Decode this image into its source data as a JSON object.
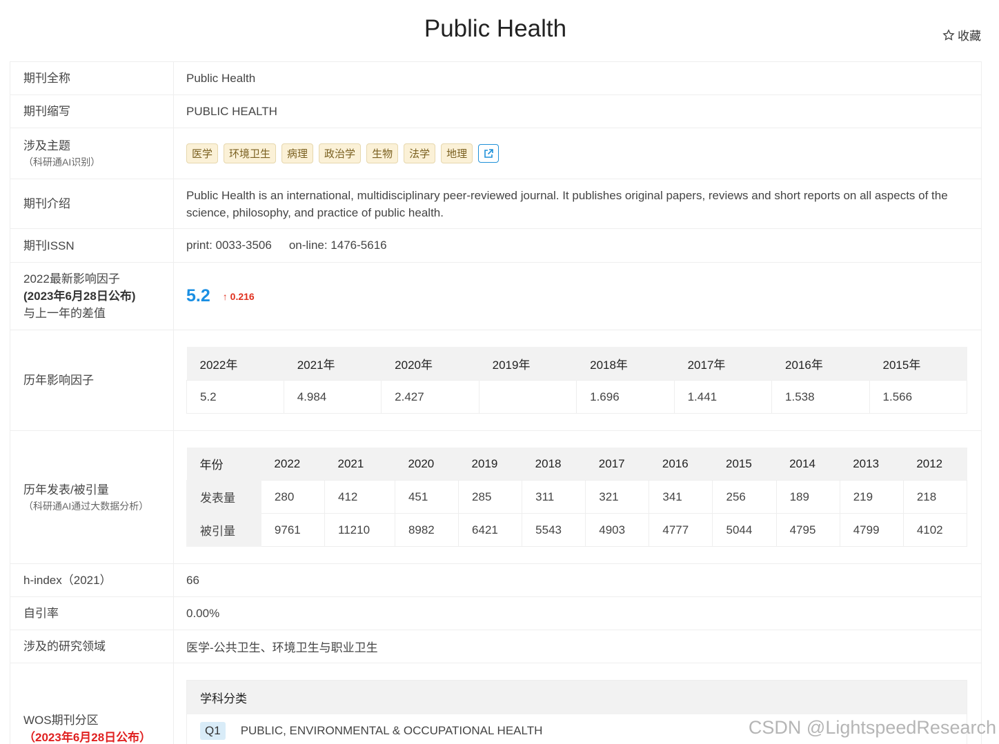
{
  "header": {
    "title": "Public Health",
    "favorite_label": "收藏",
    "favorite_icon": "star-outline-icon"
  },
  "rows": {
    "full_name": {
      "label": "期刊全称",
      "value": "Public Health"
    },
    "abbr": {
      "label": "期刊缩写",
      "value": "PUBLIC HEALTH"
    },
    "topics": {
      "label": "涉及主题",
      "sublabel": "（科研通AI识别）",
      "tags": [
        "医学",
        "环境卫生",
        "病理",
        "政治学",
        "生物",
        "法学",
        "地理"
      ],
      "link_icon": "external-link-icon"
    },
    "intro": {
      "label": "期刊介绍",
      "value": "Public Health is an international, multidisciplinary peer-reviewed journal. It publishes original papers, reviews and short reports on all aspects of the science, philosophy, and practice of public health."
    },
    "issn": {
      "label": "期刊ISSN",
      "print": "print: 0033-3506",
      "online": "on-line: 1476-5616"
    },
    "impact": {
      "label_line1": "2022最新影响因子",
      "label_line2": "(2023年6月28日公布)",
      "label_line3": "与上一年的差值",
      "value": "5.2",
      "delta": "↑ 0.216"
    },
    "history_if": {
      "label": "历年影响因子",
      "years": [
        "2022年",
        "2021年",
        "2020年",
        "2019年",
        "2018年",
        "2017年",
        "2016年",
        "2015年"
      ],
      "values": [
        "5.2",
        "4.984",
        "2.427",
        "",
        "1.696",
        "1.441",
        "1.538",
        "1.566"
      ]
    },
    "publications": {
      "label": "历年发表/被引量",
      "sublabel": "（科研通AI通过大数据分析）",
      "corner": "年份",
      "years": [
        "2022",
        "2021",
        "2020",
        "2019",
        "2018",
        "2017",
        "2016",
        "2015",
        "2014",
        "2013",
        "2012"
      ],
      "published_label": "发表量",
      "published": [
        "280",
        "412",
        "451",
        "285",
        "311",
        "321",
        "341",
        "256",
        "189",
        "219",
        "218"
      ],
      "cited_label": "被引量",
      "cited": [
        "9761",
        "11210",
        "8982",
        "6421",
        "5543",
        "4903",
        "4777",
        "5044",
        "4795",
        "4799",
        "4102"
      ]
    },
    "hindex": {
      "label": "h-index（2021）",
      "value": "66"
    },
    "selfcite": {
      "label": "自引率",
      "value": "0.00%"
    },
    "field": {
      "label": "涉及的研究领域",
      "value": "医学-公共卫生、环境卫生与职业卫生"
    },
    "wos": {
      "label": "WOS期刊分区",
      "sublabel": "（2023年6月28日公布）",
      "header": "学科分类",
      "quartile": "Q1",
      "category": "PUBLIC, ENVIRONMENTAL & OCCUPATIONAL HEALTH"
    }
  },
  "watermark": "CSDN @LightspeedResearch"
}
